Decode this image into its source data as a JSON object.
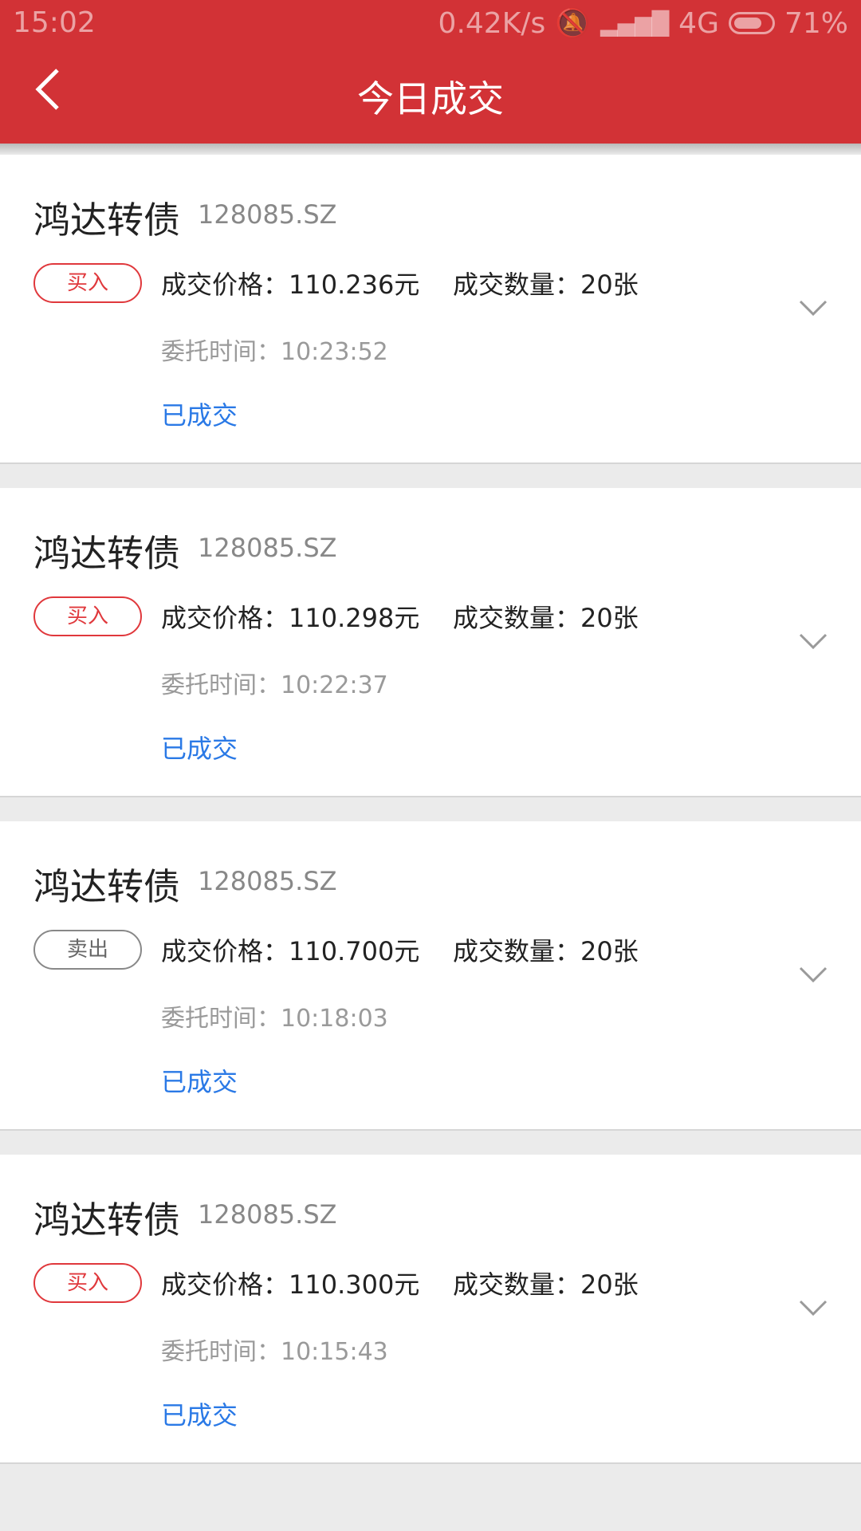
{
  "status_bar": {
    "time": "15:02",
    "speed": "0.42K/s",
    "network": "4G",
    "battery": "71%"
  },
  "header": {
    "title": "今日成交",
    "back_icon": "chevron-left-icon"
  },
  "labels": {
    "price": "成交价格：",
    "quantity": "成交数量：",
    "order_time": "委托时间："
  },
  "orders": [
    {
      "name": "鸿达转债",
      "code": "128085.SZ",
      "side": "买入",
      "price": "110.236元",
      "quantity": "20张",
      "time": "10:23:52",
      "status": "已成交"
    },
    {
      "name": "鸿达转债",
      "code": "128085.SZ",
      "side": "买入",
      "price": "110.298元",
      "quantity": "20张",
      "time": "10:22:37",
      "status": "已成交"
    },
    {
      "name": "鸿达转债",
      "code": "128085.SZ",
      "side": "卖出",
      "price": "110.700元",
      "quantity": "20张",
      "time": "10:18:03",
      "status": "已成交"
    },
    {
      "name": "鸿达转债",
      "code": "128085.SZ",
      "side": "买入",
      "price": "110.300元",
      "quantity": "20张",
      "time": "10:15:43",
      "status": "已成交"
    }
  ],
  "colors": {
    "header_bg": "#d23236",
    "buy": "#e0383c",
    "sell": "#888888",
    "status": "#2a79e6"
  }
}
